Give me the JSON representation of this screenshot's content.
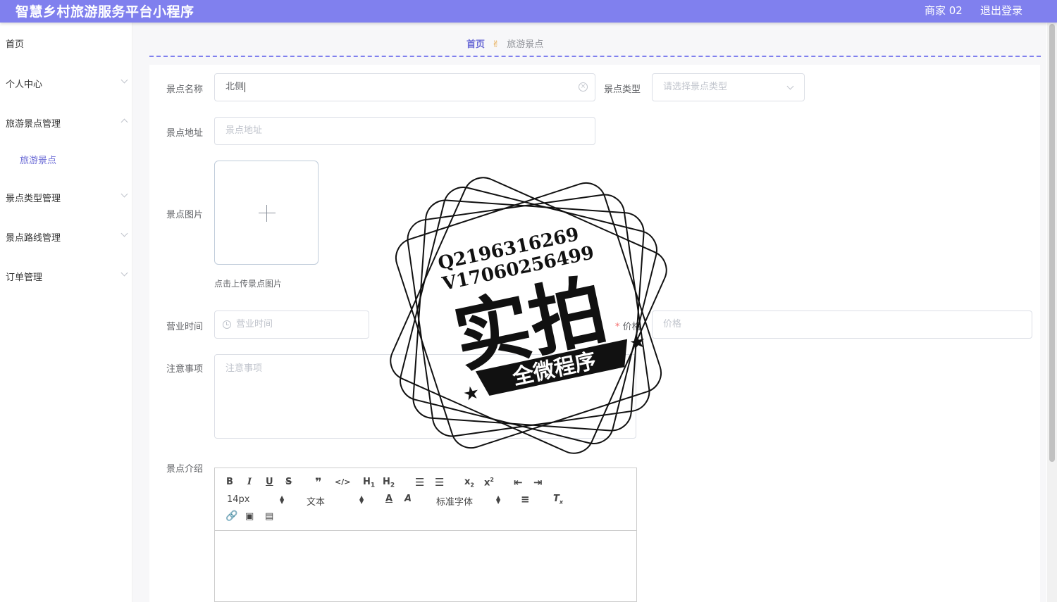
{
  "header": {
    "app_title": "智慧乡村旅游服务平台小程序",
    "user": "商家 02",
    "logout": "退出登录"
  },
  "sidebar": {
    "items": [
      {
        "label": "首页"
      },
      {
        "label": "个人中心"
      },
      {
        "label": "旅游景点管理"
      },
      {
        "label": "旅游景点"
      },
      {
        "label": "景点类型管理"
      },
      {
        "label": "景点路线管理"
      },
      {
        "label": "订单管理"
      }
    ]
  },
  "breadcrumb": {
    "home": "首页",
    "current": "旅游景点"
  },
  "form": {
    "name_label": "景点名称",
    "name_value": "北侧",
    "type_label": "景点类型",
    "type_placeholder": "请选择景点类型",
    "address_label": "景点地址",
    "address_placeholder": "景点地址",
    "image_label": "景点图片",
    "upload_tip": "点击上传景点图片",
    "hours_label": "营业时间",
    "hours_placeholder": "营业时间",
    "price_label": "价格",
    "price_placeholder": "价格",
    "notes_label": "注意事项",
    "notes_placeholder": "注意事项",
    "intro_label": "景点介绍"
  },
  "editor": {
    "font_size": "14px",
    "text_style": "文本",
    "font_family": "标准字体"
  },
  "watermark": {
    "line1": "Q2196316269",
    "line2": "V17060256499",
    "main": "实拍",
    "banner": "全微程序"
  }
}
